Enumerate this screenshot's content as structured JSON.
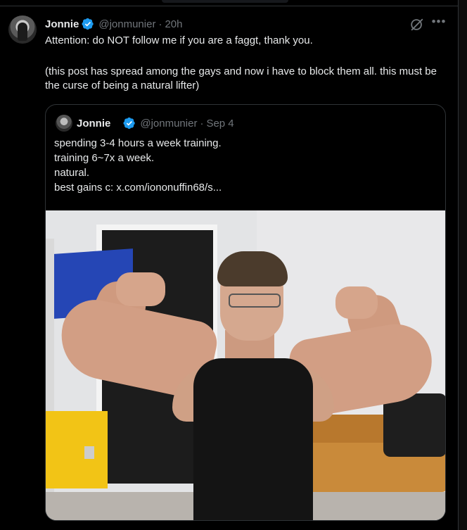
{
  "tweet": {
    "author_name": "Jonnie",
    "handle": "@jonmunier",
    "separator": "·",
    "time": "20h",
    "text_line1": "Attention: do NOT follow me if you are a faggt, thank you.",
    "text_line2": "(this post has spread among the gays and now i have to block them all. this must be the curse of being a natural lifter)"
  },
  "quoted_tweet": {
    "author_name": "Jonnie",
    "handle": "@jonmunier",
    "separator": "·",
    "date": "Sep 4",
    "lines": [
      "spending 3-4 hours a week training.",
      "training 6~7x a week.",
      "natural.",
      "best gains c:  x.com/iononuffin68/s..."
    ]
  },
  "icons": {
    "verified": "verified-badge-icon",
    "grok": "grok-icon",
    "more": "more-options-icon"
  },
  "colors": {
    "background": "#000000",
    "text": "#e7e9ea",
    "muted": "#71767b",
    "verified": "#1d9bf0",
    "border": "#2f3336"
  }
}
